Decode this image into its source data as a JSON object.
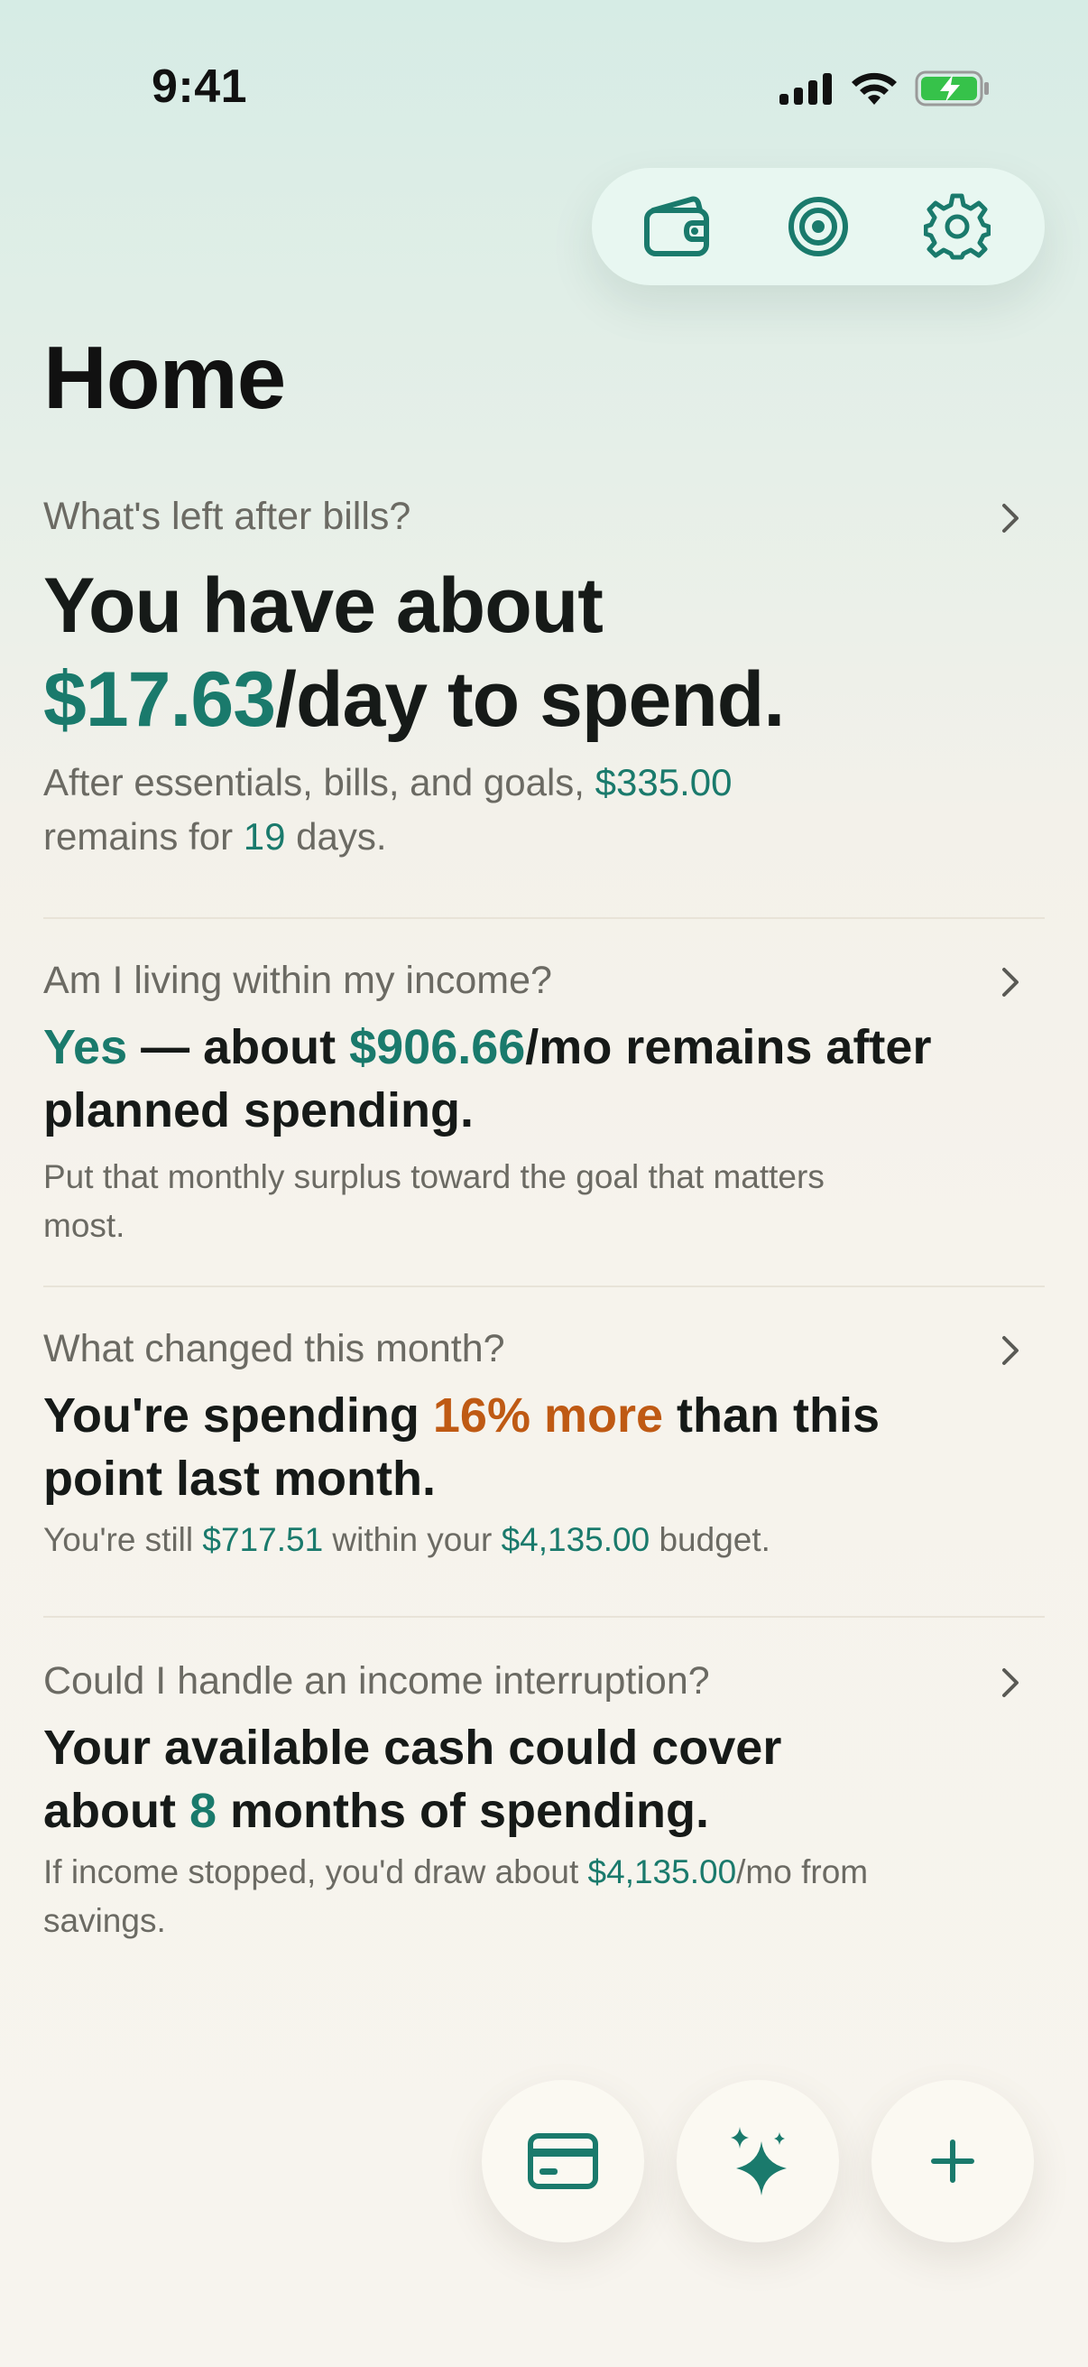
{
  "status_bar": {
    "time": "9:41"
  },
  "toolbar": {
    "icons": [
      "wallet-icon",
      "target-icon",
      "gear-icon"
    ]
  },
  "page": {
    "title": "Home"
  },
  "cards": {
    "daily": {
      "question": "What's left after bills?",
      "headline_pre": "You have about",
      "amount": "$17.63",
      "headline_post": "/day to spend.",
      "sub_pre": "After essentials, bills, and goals, ",
      "remaining": "$335.00",
      "sub_mid": " remains for ",
      "days": "19",
      "sub_post": " days."
    },
    "income": {
      "question": "Am I living within my income?",
      "answer": "Yes",
      "headline_mid": " — about ",
      "amount": "$906.66",
      "headline_post": "/mo remains after planned spending.",
      "sub": "Put that monthly surplus toward the goal that matters most."
    },
    "change": {
      "question": "What changed this month?",
      "headline_pre": "You're spending ",
      "delta": "16% more",
      "headline_post": " than this point last month.",
      "sub_pre": "You're still ",
      "within": "$717.51",
      "sub_mid": " within your ",
      "budget": "$4,135.00",
      "sub_post": " budget."
    },
    "runway": {
      "question": "Could I handle an income interruption?",
      "headline_pre": "Your available cash could cover about ",
      "months": "8",
      "headline_post": " months of spending.",
      "sub_pre": "If income stopped, you'd draw about ",
      "draw": "$4,135.00",
      "sub_post": "/mo from savings."
    }
  },
  "fabs": {
    "icons": [
      "credit-card-icon",
      "sparkle-icon",
      "plus-icon"
    ]
  },
  "colors": {
    "accent": "#1a7a6c",
    "warning": "#bf5a14",
    "text": "#161a18",
    "muted": "#6b6a63"
  }
}
